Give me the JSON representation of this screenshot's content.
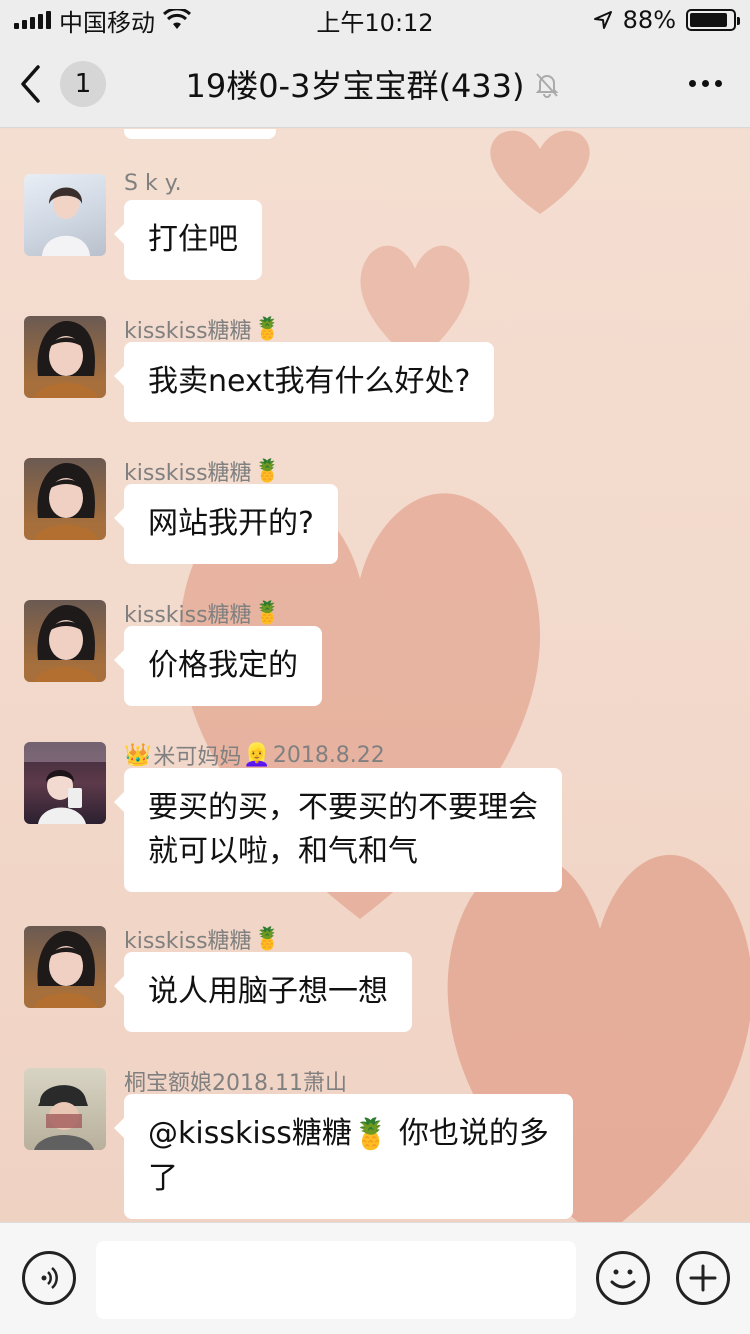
{
  "status_bar": {
    "carrier": "中国移动",
    "time": "上午10:12",
    "battery": "88%",
    "battery_level": 0.88
  },
  "nav": {
    "unread_count": "1",
    "title": "19楼0-3岁宝宝群(433)"
  },
  "messages": [
    {
      "sender": "S k y.",
      "text": "打住吧"
    },
    {
      "sender": "kisskiss糖糖",
      "text": "我卖next我有什么好处?"
    },
    {
      "sender": "kisskiss糖糖",
      "text": "网站我开的?"
    },
    {
      "sender": "kisskiss糖糖",
      "text": "价格我定的"
    },
    {
      "sender": "米可妈妈",
      "sender_suffix": "2018.8.22",
      "text_line1": "要买的买，不要买的不要理会",
      "text_line2": "就可以啦，和气和气"
    },
    {
      "sender": "kisskiss糖糖",
      "text": "说人用脑子想一想"
    },
    {
      "sender": "桐宝额娘2018.11萧山",
      "text_prefix": "@kisskiss糖糖",
      "text_suffix": " 你也说的多",
      "text_line2": "了"
    }
  ],
  "colors": {
    "header_bg": "#ededed",
    "bubble_bg": "#ffffff",
    "chat_bg": "#f3dccf",
    "heart": "#e3a48f"
  }
}
